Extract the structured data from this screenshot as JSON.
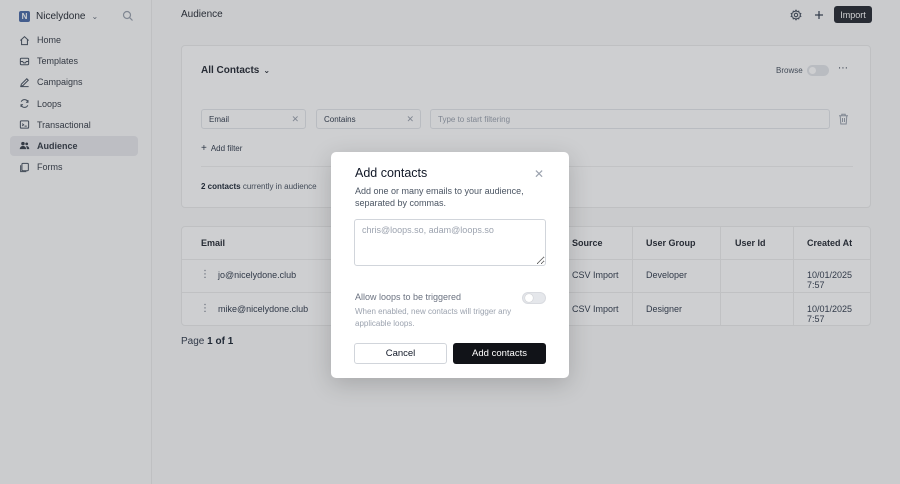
{
  "sidebar": {
    "workspace": {
      "initial": "N",
      "name": "Nicelydone"
    },
    "items": [
      {
        "label": "Home",
        "icon": "home-icon"
      },
      {
        "label": "Templates",
        "icon": "templates-icon"
      },
      {
        "label": "Campaigns",
        "icon": "campaigns-icon"
      },
      {
        "label": "Loops",
        "icon": "loops-icon"
      },
      {
        "label": "Transactional",
        "icon": "transactional-icon"
      },
      {
        "label": "Audience",
        "icon": "audience-icon",
        "active": true
      },
      {
        "label": "Forms",
        "icon": "forms-icon"
      }
    ]
  },
  "header": {
    "title": "Audience",
    "import_label": "Import"
  },
  "filters": {
    "view_label": "All Contacts",
    "browse_label": "Browse",
    "field": "Email",
    "operator": "Contains",
    "value_placeholder": "Type to start filtering",
    "add_filter_label": "Add filter",
    "count_strong": "2 contacts",
    "count_rest": "currently in audience"
  },
  "table": {
    "columns": [
      "Email",
      "Source",
      "User Group",
      "User Id",
      "Created At"
    ],
    "rows": [
      {
        "email": "jo@nicelydone.club",
        "source": "CSV Import",
        "user_group": "Developer",
        "user_id": "",
        "created_at": "10/01/2025 7:57"
      },
      {
        "email": "mike@nicelydone.club",
        "source": "CSV Import",
        "user_group": "Designer",
        "user_id": "",
        "created_at": "10/01/2025 7:57"
      }
    ]
  },
  "pager": {
    "prefix": "Page",
    "current": "1 of 1"
  },
  "modal": {
    "title": "Add contacts",
    "description": "Add one or many emails to your audience, separated by commas.",
    "textarea_placeholder": "chris@loops.so, adam@loops.so",
    "allow_label": "Allow loops to be triggered",
    "allow_help": "When enabled, new contacts will trigger any applicable loops.",
    "cancel_label": "Cancel",
    "submit_label": "Add contacts"
  }
}
